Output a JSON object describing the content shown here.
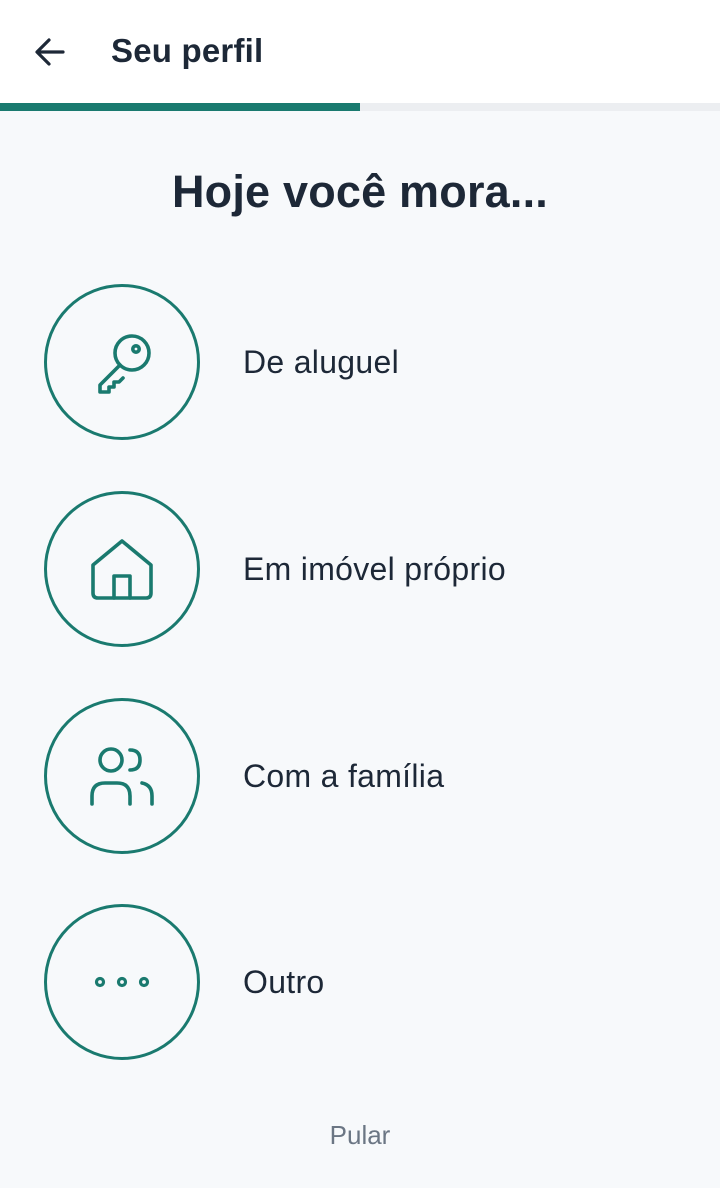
{
  "header": {
    "title": "Seu perfil",
    "back_icon": "arrow-left-icon"
  },
  "progress": {
    "fraction": 0.5,
    "color": "#1a7a6f"
  },
  "question": "Hoje você mora...",
  "options": [
    {
      "label": "De aluguel",
      "icon": "key-icon"
    },
    {
      "label": "Em imóvel próprio",
      "icon": "house-icon"
    },
    {
      "label": "Com a família",
      "icon": "users-icon"
    },
    {
      "label": "Outro",
      "icon": "more-dots-icon"
    }
  ],
  "skip_label": "Pular",
  "colors": {
    "accent": "#1a7a6f",
    "text": "#1d2837",
    "muted": "#6b7684",
    "background": "#f7f9fb"
  }
}
